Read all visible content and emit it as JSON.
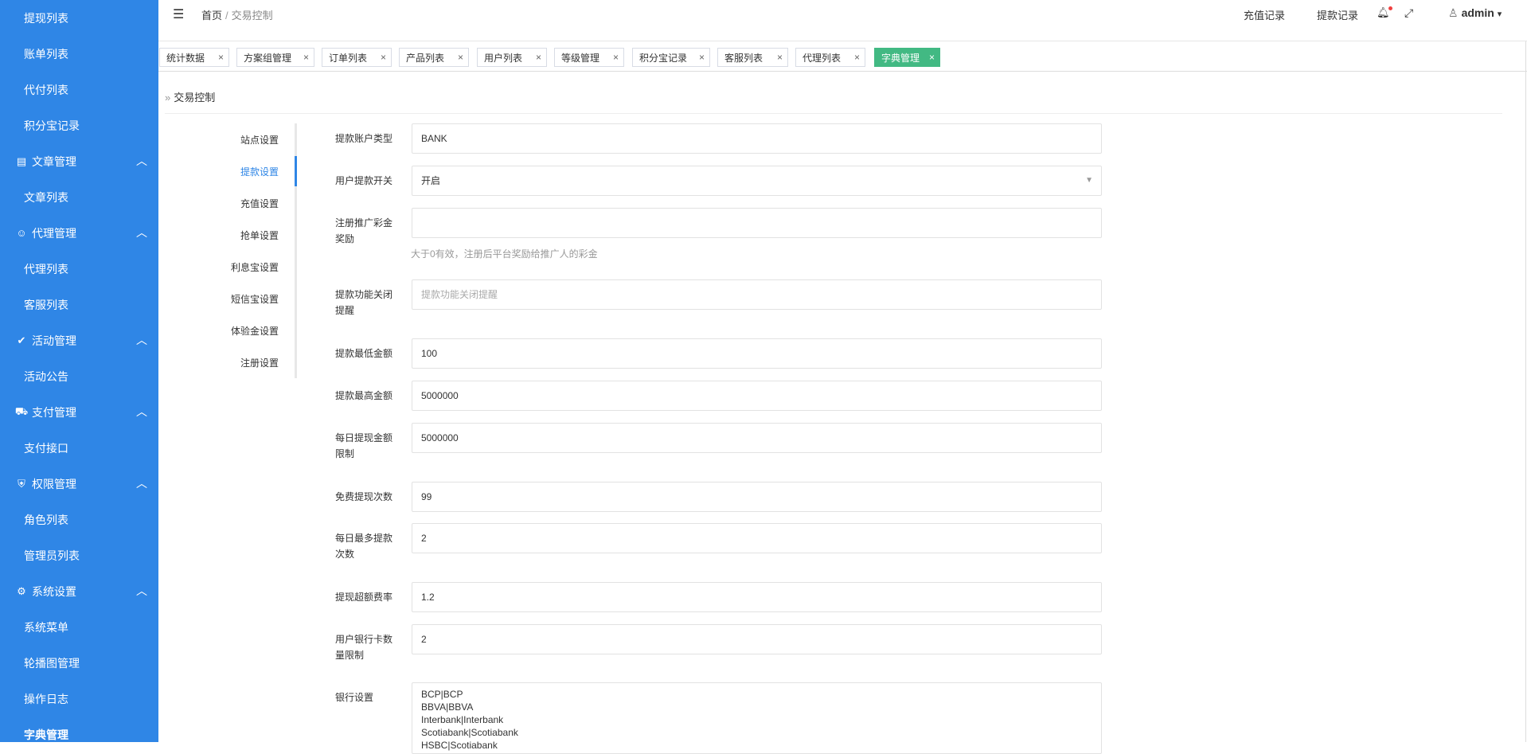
{
  "sidebar": {
    "items": {
      "withdraw_list": "提现列表",
      "bill_list": "账单列表",
      "payout_list": "代付列表",
      "points_record": "积分宝记录",
      "article_group": "文章管理",
      "article_list": "文章列表",
      "agent_group": "代理管理",
      "agent_list": "代理列表",
      "service_list": "客服列表",
      "activity_group": "活动管理",
      "activity_notice": "活动公告",
      "payment_group": "支付管理",
      "payment_api": "支付接口",
      "permission_group": "权限管理",
      "role_list": "角色列表",
      "admin_list": "管理员列表",
      "system_group": "系统设置",
      "system_menu": "系统菜单",
      "carousel": "轮播图管理",
      "operation_log": "操作日志",
      "dict_manage": "字典管理"
    }
  },
  "header": {
    "breadcrumb_home": "首页",
    "breadcrumb_sep": "/",
    "breadcrumb_current": "交易控制",
    "recharge_record": "充值记录",
    "withdraw_record": "提款记录",
    "username": "admin"
  },
  "tabs": {
    "t1": "统计数据",
    "t2": "方案组管理",
    "t3": "订单列表",
    "t4": "产品列表",
    "t5": "用户列表",
    "t6": "等级管理",
    "t7": "积分宝记录",
    "t8": "客服列表",
    "t9": "代理列表",
    "t10": "字典管理",
    "close": "×"
  },
  "page": {
    "title": "交易控制"
  },
  "subnav": {
    "site": "站点设置",
    "withdraw": "提款设置",
    "recharge": "充值设置",
    "grab": "抢单设置",
    "interest": "利息宝设置",
    "sms": "短信宝设置",
    "trial": "体验金设置",
    "register": "注册设置"
  },
  "form": {
    "account_type_label": "提款账户类型",
    "account_type_value": "BANK",
    "switch_label": "用户提款开关",
    "switch_value": "开启",
    "reward_label": "注册推广彩金奖励",
    "reward_value": "",
    "reward_help": "大于0有效，注册后平台奖励给推广人的彩金",
    "close_tip_label": "提款功能关闭提醒",
    "close_tip_placeholder": "提款功能关闭提醒",
    "min_label": "提款最低金额",
    "min_value": "100",
    "max_label": "提款最高金额",
    "max_value": "5000000",
    "daily_limit_label": "每日提现金额限制",
    "daily_limit_value": "5000000",
    "free_times_label": "免费提现次数",
    "free_times_value": "99",
    "daily_times_label": "每日最多提款次数",
    "daily_times_value": "2",
    "overfee_label": "提现超额费率",
    "overfee_value": "1.2",
    "card_limit_label": "用户银行卡数量限制",
    "card_limit_value": "2",
    "bank_label": "银行设置",
    "bank_lines": [
      "BCP|BCP",
      "BBVA|BBVA",
      "Interbank|Interbank",
      "Scotiabank|Scotiabank",
      "HSBC|Scotiabank"
    ]
  },
  "icons": {
    "hamburger": "menu-fold-icon",
    "bell": "bell-icon",
    "fullscreen": "fullscreen-icon",
    "user": "user-icon"
  },
  "colors": {
    "sidebar": "#2f86e6",
    "accent": "#2f86e6",
    "active_tab": "#42b983"
  }
}
